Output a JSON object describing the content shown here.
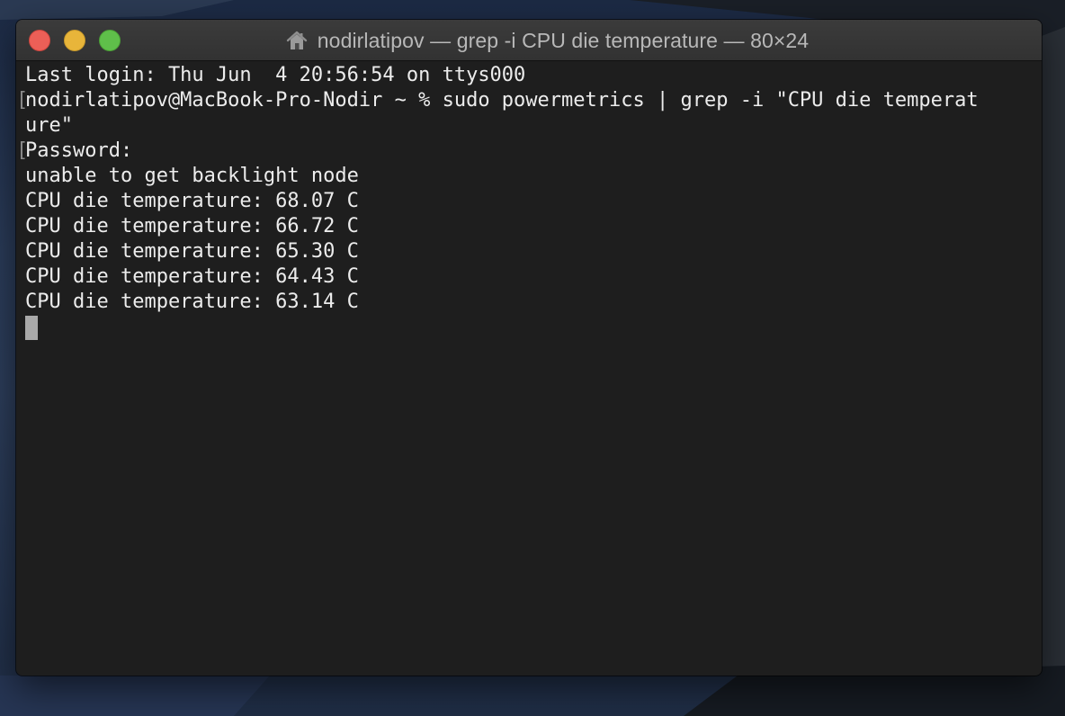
{
  "window": {
    "title": "nodirlatipov — grep -i CPU die temperature — 80×24",
    "title_icon": "home-icon",
    "buttons": {
      "close": "close-button",
      "minimize": "minimize-button",
      "zoom": "zoom-button"
    }
  },
  "terminal": {
    "lines": [
      "Last login: Thu Jun  4 20:56:54 on ttys000",
      "nodirlatipov@MacBook-Pro-Nodir ~ % sudo powermetrics | grep -i \"CPU die temperat",
      "ure\"",
      "Password:",
      "unable to get backlight node",
      "CPU die temperature: 68.07 C",
      "CPU die temperature: 66.72 C",
      "CPU die temperature: 65.30 C",
      "CPU die temperature: 64.43 C",
      "CPU die temperature: 63.14 C"
    ],
    "bracket_left": "[",
    "bracket_right": "]"
  },
  "colors": {
    "background": "#1e1e1e",
    "text": "#ececec",
    "titlebar": "#353535",
    "close": "#ec5f57",
    "minimize": "#e8b53a",
    "zoom": "#5fbf4a"
  }
}
